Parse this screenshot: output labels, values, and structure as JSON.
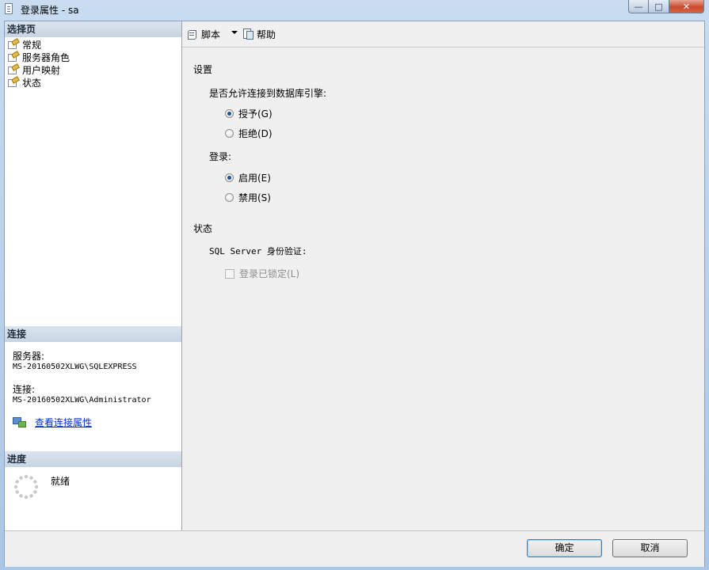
{
  "window": {
    "title": "登录属性 - sa",
    "minimize_label": "—",
    "maximize_label": "□",
    "close_label": "✕"
  },
  "left": {
    "select_page_header": "选择页",
    "pages": [
      {
        "label": "常规",
        "icon": "page-icon"
      },
      {
        "label": "服务器角色",
        "icon": "page-icon"
      },
      {
        "label": "用户映射",
        "icon": "page-icon"
      },
      {
        "label": "状态",
        "icon": "page-icon"
      }
    ],
    "connection_header": "连接",
    "server_label": "服务器:",
    "server_value": "MS-20160502XLWG\\SQLEXPRESS",
    "connection_label": "连接:",
    "connection_value": "MS-20160502XLWG\\Administrator",
    "view_connection_link": "查看连接属性",
    "progress_header": "进度",
    "progress_status": "就绪"
  },
  "toolbar": {
    "script_label": "脚本",
    "help_label": "帮助"
  },
  "settings": {
    "heading": "设置",
    "permission_question": "是否允许连接到数据库引擎:",
    "grant_label": "授予(G)",
    "deny_label": "拒绝(D)",
    "login_label": "登录:",
    "enable_label": "启用(E)",
    "disable_label": "禁用(S)",
    "selected_permission": "grant",
    "selected_login": "enable"
  },
  "status": {
    "heading": "状态",
    "sql_auth_label": "SQL Server 身份验证:",
    "locked_label": "登录已锁定(L)",
    "locked_checked": false
  },
  "footer": {
    "ok_label": "确定",
    "cancel_label": "取消"
  }
}
